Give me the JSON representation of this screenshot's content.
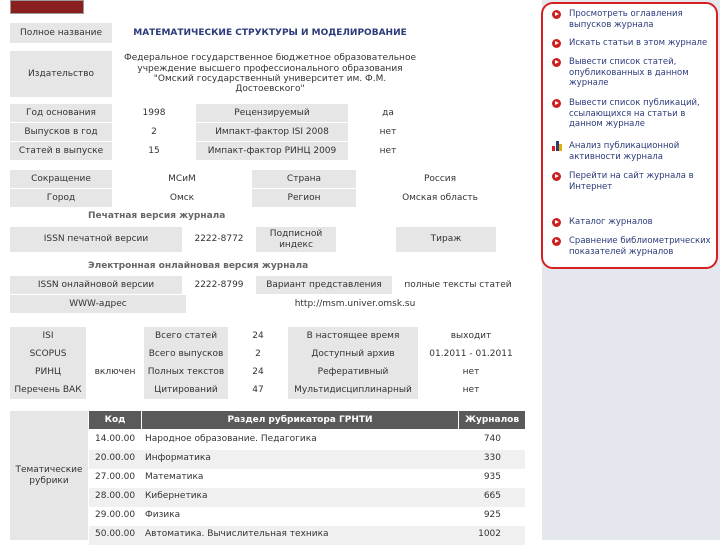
{
  "info": {
    "full_name_label": "Полное название",
    "full_name": "МАТЕМАТИЧЕСКИЕ СТРУКТУРЫ И МОДЕЛИРОВАНИЕ",
    "publisher_label": "Издательство",
    "publisher": "Федеральное государственное бюджетное образовательное учреждение высшего профессионального образования \"Омский государственный университет им. Ф.М. Достоевского\"",
    "founded_label": "Год основания",
    "founded": "1998",
    "reviewed_label": "Рецензируемый",
    "reviewed": "да",
    "issues_per_year_label": "Выпусков в год",
    "issues_per_year": "2",
    "isi_if_label": "Импакт-фактор ISI 2008",
    "isi_if": "нет",
    "articles_per_issue_label": "Статей в выпуске",
    "articles_per_issue": "15",
    "rinc_if_label": "Импакт-фактор РИНЦ 2009",
    "rinc_if": "нет",
    "abbr_label": "Сокращение",
    "abbr": "МСиМ",
    "country_label": "Страна",
    "country": "Россия",
    "city_label": "Город",
    "city": "Омск",
    "region_label": "Регион",
    "region": "Омская область"
  },
  "print": {
    "section_title": "Печатная версия журнала",
    "issn_label": "ISSN печатной версии",
    "issn": "2222-8772",
    "subscription_label": "Подписной индекс",
    "subscription": "",
    "circulation_label": "Тираж",
    "circulation": ""
  },
  "online": {
    "section_title": "Электронная онлайновая версия журнала",
    "issn_label": "ISSN онлайновой версии",
    "issn": "2222-8799",
    "variant_label": "Вариант представления",
    "variant": "полные тексты статей",
    "www_label": "WWW-адрес",
    "www": "http://msm.univer.omsk.su"
  },
  "stats": {
    "isi_label": "ISI",
    "isi": "",
    "scopus_label": "SCOPUS",
    "scopus": "",
    "rinc_label": "РИНЦ",
    "rinc": "включен",
    "vak_label": "Перечень ВАК",
    "vak": "",
    "total_articles_label": "Всего статей",
    "total_articles": "24",
    "total_issues_label": "Всего выпусков",
    "total_issues": "2",
    "full_texts_label": "Полных текстов",
    "full_texts": "24",
    "citations_label": "Цитирований",
    "citations": "47",
    "current_label": "В настоящее время",
    "current": "выходит",
    "archive_label": "Доступный архив",
    "archive": "01.2011 - 01.2011",
    "abstract_label": "Реферативный",
    "abstract": "нет",
    "multidisc_label": "Мультидисциплинарный",
    "multidisc": "нет"
  },
  "rubrics": {
    "label": "Тематические рубрики",
    "col_code": "Код",
    "col_section": "Раздел рубрикатора ГРНТИ",
    "col_journals": "Журналов",
    "rows": [
      {
        "code": "14.00.00",
        "name": "Народное образование. Педагогика",
        "count": "740"
      },
      {
        "code": "20.00.00",
        "name": "Информатика",
        "count": "330"
      },
      {
        "code": "27.00.00",
        "name": "Математика",
        "count": "935"
      },
      {
        "code": "28.00.00",
        "name": "Кибернетика",
        "count": "665"
      },
      {
        "code": "29.00.00",
        "name": "Физика",
        "count": "925"
      },
      {
        "code": "50.00.00",
        "name": "Автоматика. Вычислительная техника",
        "count": "1002"
      }
    ]
  },
  "sidebar": {
    "links": [
      {
        "text": "Просмотреть оглавления выпусков журнала",
        "icon": "red-arrow-icon"
      },
      {
        "text": "Искать статьи в этом журнале",
        "icon": "red-arrow-icon"
      },
      {
        "text": "Вывести список статей, опубликованных в данном журнале",
        "icon": "red-arrow-icon"
      },
      {
        "text": "Вывести список публикаций, ссылающихся на статьи в данном журнале",
        "icon": "red-arrow-icon"
      },
      {
        "text": "Анализ публикационной активности журнала",
        "icon": "bar-chart-icon"
      },
      {
        "text": "Перейти на сайт журнала в Интернет",
        "icon": "red-arrow-icon"
      },
      {
        "text": "Каталог журналов",
        "icon": "red-arrow-icon"
      },
      {
        "text": "Сравнение библиометрических показателей журналов",
        "icon": "red-arrow-icon"
      }
    ],
    "highlight_color": "#d42020"
  }
}
